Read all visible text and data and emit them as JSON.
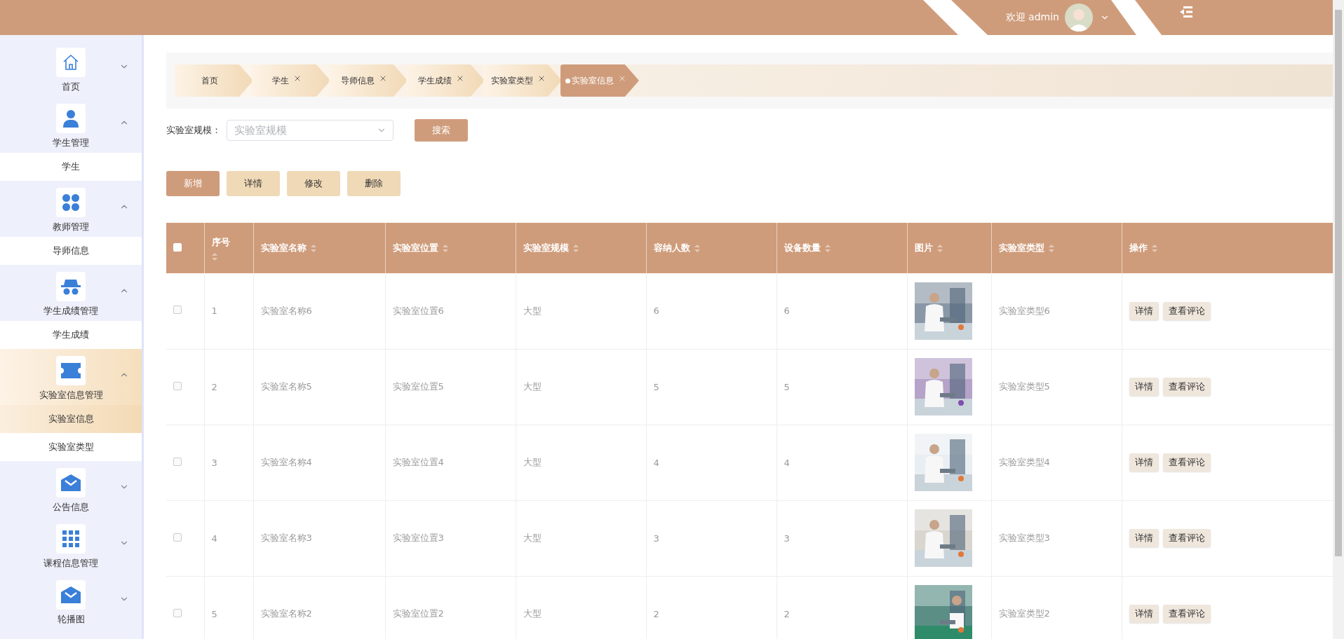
{
  "header": {
    "welcome": "欢迎 admin"
  },
  "sidebar": {
    "items": [
      {
        "label": "首页",
        "expanded": false,
        "selected": false
      },
      {
        "label": "学生管理",
        "expanded": true,
        "selected": false,
        "children": [
          {
            "label": "学生",
            "selected": false
          }
        ]
      },
      {
        "label": "教师管理",
        "expanded": true,
        "selected": false,
        "children": [
          {
            "label": "导师信息",
            "selected": false
          }
        ]
      },
      {
        "label": "学生成绩管理",
        "expanded": true,
        "selected": false,
        "children": [
          {
            "label": "学生成绩",
            "selected": false
          }
        ]
      },
      {
        "label": "实验室信息管理",
        "expanded": true,
        "selected": true,
        "children": [
          {
            "label": "实验室信息",
            "selected": true
          },
          {
            "label": "实验室类型",
            "selected": false
          }
        ]
      },
      {
        "label": "公告信息",
        "expanded": false,
        "selected": false
      },
      {
        "label": "课程信息管理",
        "expanded": false,
        "selected": false
      },
      {
        "label": "轮播图",
        "expanded": false,
        "selected": false
      }
    ]
  },
  "tabs": [
    {
      "label": "首页",
      "selected": false,
      "closable": false
    },
    {
      "label": "学生",
      "selected": false,
      "closable": true
    },
    {
      "label": "导师信息",
      "selected": false,
      "closable": true
    },
    {
      "label": "学生成绩",
      "selected": false,
      "closable": true
    },
    {
      "label": "实验室类型",
      "selected": false,
      "closable": true
    },
    {
      "label": "实验室信息",
      "selected": true,
      "closable": true
    }
  ],
  "search": {
    "label": "实验室规模：",
    "placeholder": "实验室规模",
    "button": "搜索"
  },
  "actions": [
    {
      "label": "新增",
      "kind": "primary"
    },
    {
      "label": "详情",
      "kind": "secondary"
    },
    {
      "label": "修改",
      "kind": "secondary"
    },
    {
      "label": "删除",
      "kind": "secondary"
    }
  ],
  "table": {
    "select_all": {
      "checked": false
    },
    "columns": [
      "序号",
      "实验室名称",
      "实验室位置",
      "实验室规模",
      "容纳人数",
      "设备数量",
      "图片",
      "实验室类型",
      "操作"
    ],
    "rows": [
      {
        "selected": false,
        "index": "1",
        "name": "实验室名称6",
        "location": "实验室位置6",
        "scale": "大型",
        "capacity": "6",
        "equipment": "6",
        "type": "实验室类型6",
        "actions": [
          "详情",
          "查看评论"
        ]
      },
      {
        "selected": false,
        "index": "2",
        "name": "实验室名称5",
        "location": "实验室位置5",
        "scale": "大型",
        "capacity": "5",
        "equipment": "5",
        "type": "实验室类型5",
        "actions": [
          "详情",
          "查看评论"
        ]
      },
      {
        "selected": false,
        "index": "3",
        "name": "实验室名称4",
        "location": "实验室位置4",
        "scale": "大型",
        "capacity": "4",
        "equipment": "4",
        "type": "实验室类型4",
        "actions": [
          "详情",
          "查看评论"
        ]
      },
      {
        "selected": false,
        "index": "4",
        "name": "实验室名称3",
        "location": "实验室位置3",
        "scale": "大型",
        "capacity": "3",
        "equipment": "3",
        "type": "实验室类型3",
        "actions": [
          "详情",
          "查看评论"
        ]
      },
      {
        "selected": false,
        "index": "5",
        "name": "实验室名称2",
        "location": "实验室位置2",
        "scale": "大型",
        "capacity": "2",
        "equipment": "2",
        "type": "实验室类型2",
        "actions": [
          "详情",
          "查看评论"
        ]
      }
    ]
  }
}
